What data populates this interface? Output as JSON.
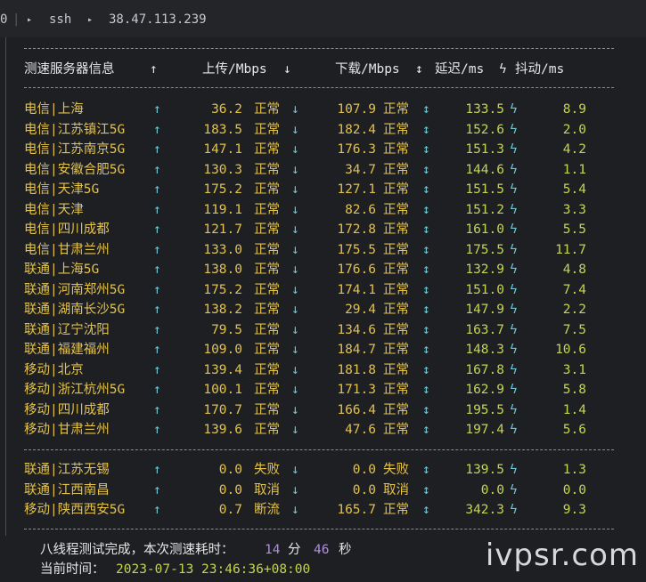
{
  "titlebar": {
    "tab_marker": "0",
    "segments": [
      "ssh",
      "38.47.113.239"
    ]
  },
  "header": {
    "server": "测速服务器信息",
    "up_arrow": "↑",
    "upload": "上传/Mbps",
    "down_arrow": "↓",
    "download": "下载/Mbps",
    "updown": "↕",
    "latency": "延迟/ms",
    "bolt": "ϟ",
    "jitter": "抖动/ms"
  },
  "rows": [
    {
      "server": "电信|上海",
      "up": "36.2",
      "up_status": "正常",
      "down": "107.9",
      "down_status": "正常",
      "latency": "133.5",
      "jitter": "8.9"
    },
    {
      "server": "电信|江苏镇江5G",
      "up": "183.5",
      "up_status": "正常",
      "down": "182.4",
      "down_status": "正常",
      "latency": "152.6",
      "jitter": "2.0"
    },
    {
      "server": "电信|江苏南京5G",
      "up": "147.1",
      "up_status": "正常",
      "down": "176.3",
      "down_status": "正常",
      "latency": "151.3",
      "jitter": "4.2"
    },
    {
      "server": "电信|安徽合肥5G",
      "up": "130.3",
      "up_status": "正常",
      "down": "34.7",
      "down_status": "正常",
      "latency": "144.6",
      "jitter": "1.1"
    },
    {
      "server": "电信|天津5G",
      "up": "175.2",
      "up_status": "正常",
      "down": "127.1",
      "down_status": "正常",
      "latency": "151.5",
      "jitter": "5.4"
    },
    {
      "server": "电信|天津",
      "up": "119.1",
      "up_status": "正常",
      "down": "82.6",
      "down_status": "正常",
      "latency": "151.2",
      "jitter": "3.3"
    },
    {
      "server": "电信|四川成都",
      "up": "121.7",
      "up_status": "正常",
      "down": "172.8",
      "down_status": "正常",
      "latency": "161.0",
      "jitter": "5.5"
    },
    {
      "server": "电信|甘肃兰州",
      "up": "133.0",
      "up_status": "正常",
      "down": "175.5",
      "down_status": "正常",
      "latency": "175.5",
      "jitter": "11.7"
    },
    {
      "server": "联通|上海5G",
      "up": "138.0",
      "up_status": "正常",
      "down": "176.6",
      "down_status": "正常",
      "latency": "132.9",
      "jitter": "4.8"
    },
    {
      "server": "联通|河南郑州5G",
      "up": "175.2",
      "up_status": "正常",
      "down": "174.1",
      "down_status": "正常",
      "latency": "151.0",
      "jitter": "7.4"
    },
    {
      "server": "联通|湖南长沙5G",
      "up": "138.2",
      "up_status": "正常",
      "down": "29.4",
      "down_status": "正常",
      "latency": "147.9",
      "jitter": "2.2"
    },
    {
      "server": "联通|辽宁沈阳",
      "up": "79.5",
      "up_status": "正常",
      "down": "134.6",
      "down_status": "正常",
      "latency": "163.7",
      "jitter": "7.5"
    },
    {
      "server": "联通|福建福州",
      "up": "109.0",
      "up_status": "正常",
      "down": "184.7",
      "down_status": "正常",
      "latency": "148.3",
      "jitter": "10.6"
    },
    {
      "server": "移动|北京",
      "up": "139.4",
      "up_status": "正常",
      "down": "181.8",
      "down_status": "正常",
      "latency": "167.8",
      "jitter": "3.1"
    },
    {
      "server": "移动|浙江杭州5G",
      "up": "100.1",
      "up_status": "正常",
      "down": "171.3",
      "down_status": "正常",
      "latency": "162.9",
      "jitter": "5.8"
    },
    {
      "server": "移动|四川成都",
      "up": "170.7",
      "up_status": "正常",
      "down": "166.4",
      "down_status": "正常",
      "latency": "195.5",
      "jitter": "1.4"
    },
    {
      "server": "移动|甘肃兰州",
      "up": "139.6",
      "up_status": "正常",
      "down": "47.6",
      "down_status": "正常",
      "latency": "197.4",
      "jitter": "5.6"
    }
  ],
  "failed_rows": [
    {
      "server": "联通|江苏无锡",
      "up": "0.0",
      "up_status": "失败",
      "down": "0.0",
      "down_status": "失败",
      "latency": "139.5",
      "jitter": "1.3"
    },
    {
      "server": "联通|江西南昌",
      "up": "0.0",
      "up_status": "取消",
      "down": "0.0",
      "down_status": "取消",
      "latency": "0.0",
      "jitter": "0.0"
    },
    {
      "server": "移动|陕西西安5G",
      "up": "0.7",
      "up_status": "断流",
      "down": "165.7",
      "down_status": "正常",
      "latency": "342.3",
      "jitter": "9.3"
    }
  ],
  "summary": {
    "prefix": "八线程测试完成，本次测速耗时：",
    "minutes": "14",
    "min_unit": "分",
    "seconds": "46",
    "sec_unit": "秒",
    "time_label": "当前时间：",
    "time_value": "2023-07-13 23:46:36+08:00"
  },
  "watermark": "ivpsr.com",
  "colors": {
    "provider": "#e3c24c",
    "cyan": "#6dc8d6",
    "green": "#c6d450",
    "purple": "#b08fe0"
  }
}
